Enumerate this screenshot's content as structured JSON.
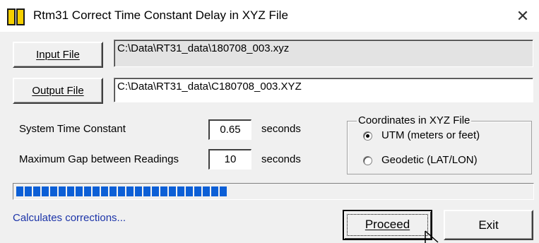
{
  "window": {
    "title": "Rtm31   Correct Time Constant Delay in XYZ File",
    "close_glyph": "✕"
  },
  "input": {
    "button_label": "Input File",
    "path": "C:\\Data\\RT31_data\\180708_003.xyz"
  },
  "output": {
    "button_label": "Output File",
    "path": "C:\\Data\\RT31_data\\C180708_003.XYZ"
  },
  "params": {
    "time_constant_label": "System Time Constant",
    "time_constant_value": "0.65",
    "time_constant_unit": "seconds",
    "max_gap_label": "Maximum Gap between Readings",
    "max_gap_value": "10",
    "max_gap_unit": "seconds"
  },
  "coordinates": {
    "legend": "Coordinates in XYZ File",
    "options": [
      {
        "label": "UTM (meters or feet)",
        "selected": true
      },
      {
        "label": "Geodetic (LAT/LON)",
        "selected": false
      }
    ]
  },
  "progress": {
    "fraction": 0.41,
    "color": "#0c5fd6"
  },
  "status_text": "Calculates corrections...",
  "actions": {
    "proceed_label": "Proceed",
    "exit_label": "Exit"
  },
  "icons": {
    "app": "rtm31-app-icon",
    "close": "close-icon"
  }
}
